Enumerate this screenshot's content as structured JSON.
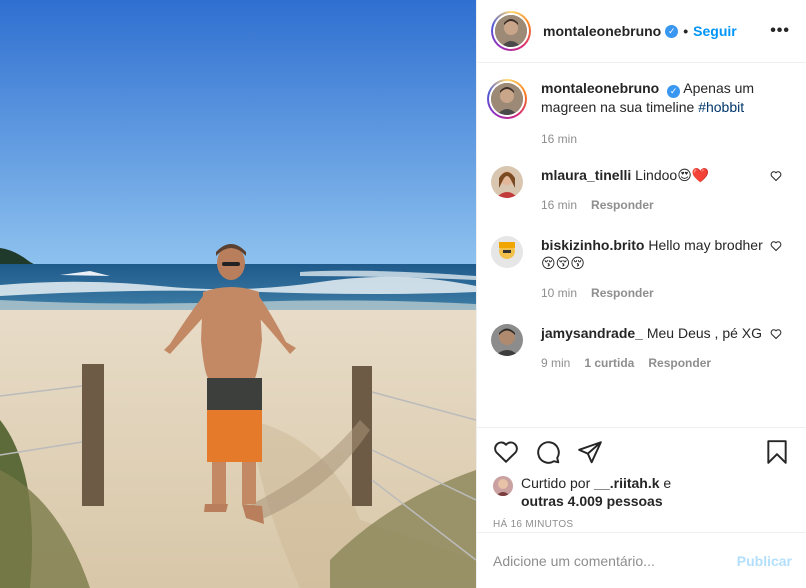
{
  "post": {
    "username": "montaleonebruno",
    "verified_mark": "✓",
    "separator": "•",
    "follow_label": "Seguir",
    "more_label": "•••",
    "caption_user": "montaleonebruno",
    "caption_text": "Apenas um magreen na sua timeline",
    "caption_tag": "#hobbit",
    "caption_time": "16 min"
  },
  "comments": [
    {
      "user": "mlaura_tinelli",
      "text": "Lindoo😍❤️",
      "time": "16 min",
      "likes": "",
      "reply": "Responder"
    },
    {
      "user": "biskizinho.brito",
      "text": "Hello may brodher 😚😚😚",
      "time": "10 min",
      "likes": "",
      "reply": "Responder"
    },
    {
      "user": "jamysandrade_",
      "text": "Meu Deus , pé XG",
      "time": "9 min",
      "likes": "1 curtida",
      "reply": "Responder"
    }
  ],
  "actions": {
    "liked_prefix": "Curtido por",
    "liked_user": "__.riitah.k",
    "liked_and": "e",
    "liked_others": "outras 4.009 pessoas",
    "time_ago": "HÁ 16 MINUTOS"
  },
  "add_comment": {
    "placeholder": "Adicione um comentário...",
    "publish_label": "Publicar"
  },
  "icons": [
    "like-icon",
    "comment-icon",
    "share-icon",
    "save-icon",
    "heart-icon"
  ],
  "colors": {
    "accent": "#0095f6",
    "verified": "#3897f0",
    "publish_disabled": "#b2dffc",
    "muted": "#8e8e8e"
  }
}
